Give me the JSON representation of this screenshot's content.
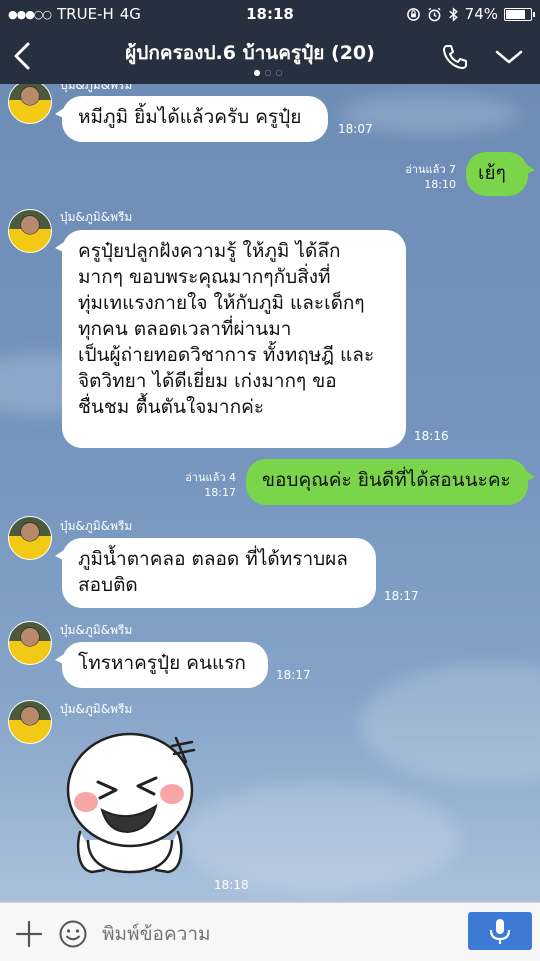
{
  "status_bar": {
    "signal_dots": "●●●○○",
    "carrier": "TRUE-H",
    "network": "4G",
    "time": "18:18",
    "battery": "74%"
  },
  "header": {
    "title": "ผู้ปกครองป.6 บ้านครูปุ๋ย (20)"
  },
  "messages": [
    {
      "sender": "บุ๋ม&ภูมิ&พรีม",
      "text": "หมีภูมิ ยิ้มได้แล้วครับ ครูปุ๋ย",
      "time": "18:07"
    },
    {
      "text": "เย้ๆ",
      "read": "อ่านแล้ว 7",
      "time": "18:10"
    },
    {
      "sender": "บุ๋ม&ภูมิ&พรีม",
      "lines": [
        "ครูปุ๋ยปลูกฝังความรู้ ให้ภูมิ ได้ลึก",
        "มากๆ ขอบพระคุณมากๆกับสิ่งที่",
        "ทุ่มเทแรงกายใจ ให้กับภูมิ และเด็กๆ",
        "ทุกคน ตลอดเวลาที่ผ่านมา",
        "เป็นผู้ถ่ายทอดวิชาการ ทั้งทฤษฎี และ",
        "จิตวิทยา ได้ดีเยี่ยม เก่งมากๆ ขอ",
        "ชื่นชม ตื้นตันใจมากค่ะ"
      ],
      "time": "18:16"
    },
    {
      "text": "ขอบคุณค่ะ ยินดีที่ได้สอนนะคะ",
      "read": "อ่านแล้ว 4",
      "time": "18:17"
    },
    {
      "sender": "บุ๋ม&ภูมิ&พรีม",
      "lines": [
        "ภูมิน้ำตาคลอ ตลอด ที่ได้ทราบผล",
        "สอบติด"
      ],
      "time": "18:17"
    },
    {
      "sender": "บุ๋ม&ภูมิ&พรีม",
      "text": "โทรหาครูปุ๋ย คนแรก",
      "time": "18:17"
    },
    {
      "sender": "บุ๋ม&ภูมิ&พรีม",
      "sticker": "laughing-face-sticker",
      "time": "18:18"
    }
  ],
  "input": {
    "placeholder": "พิมพ์ข้อความ"
  },
  "colors": {
    "header_bg": "#27303f",
    "outgoing_bubble": "#7bd54a",
    "incoming_bubble": "#ffffff",
    "mic_button": "#3d7ad6"
  }
}
